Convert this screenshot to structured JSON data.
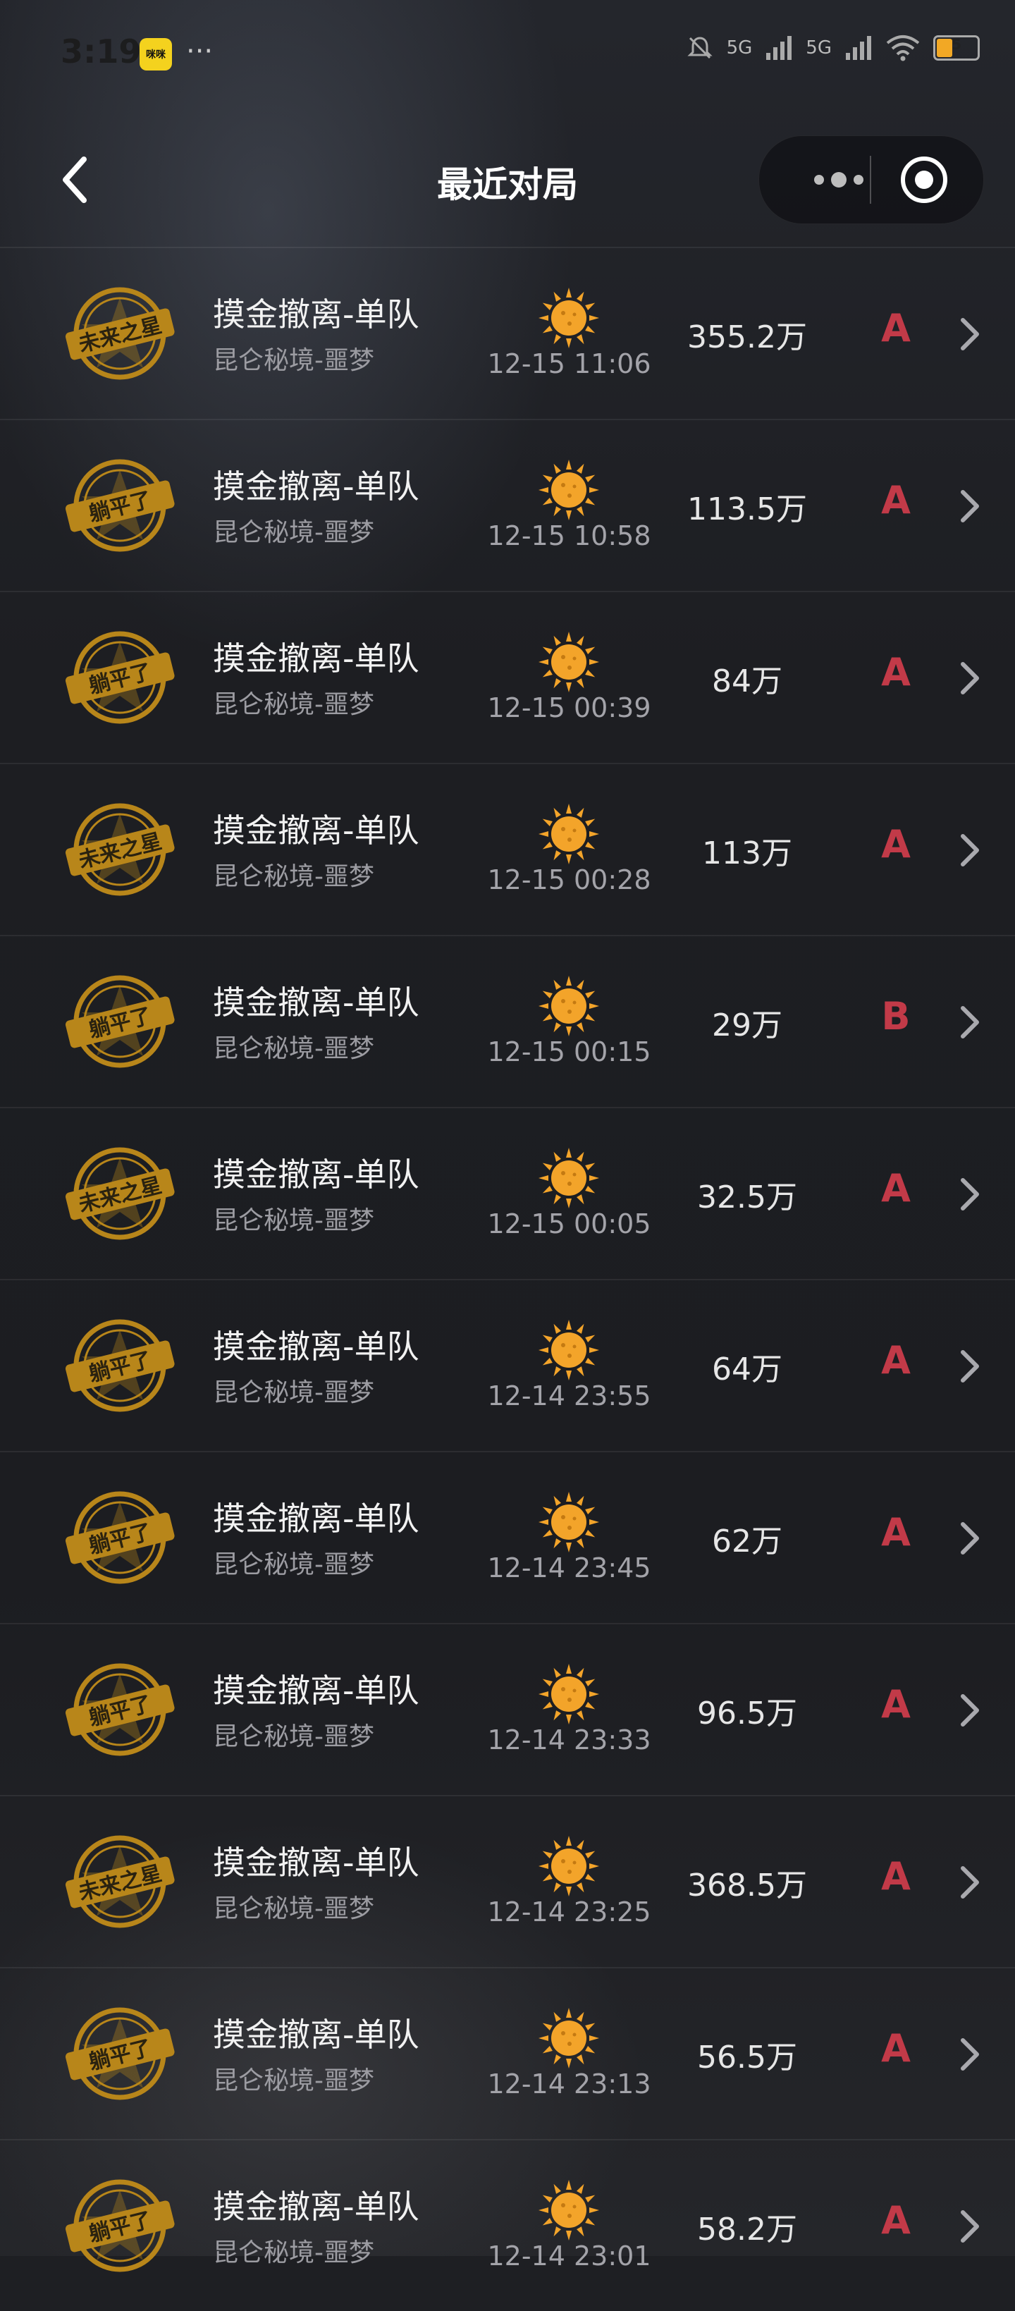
{
  "status_bar": {
    "time": "3:19",
    "app_icon_text": "咪咪",
    "more": "···",
    "battery": "5",
    "battery_color": "#f2a825",
    "network_labels": [
      "5G",
      "5G"
    ]
  },
  "header": {
    "title": "最近对局",
    "back_icon": "chevron-left-icon",
    "more_icon": "more-dots-icon",
    "close_icon": "target-close-icon"
  },
  "colors": {
    "badge_gold": "#b8861a",
    "sun_orange": "#f3a42a",
    "grade_red": "#c23a48"
  },
  "matches": [
    {
      "badge": "未来之星",
      "mode": "摸金撤离-单队",
      "map": "昆仑秘境-噩梦",
      "time": "12-15 11:06",
      "value": "355.2万",
      "grade": "A",
      "weather_icon": "sun-icon"
    },
    {
      "badge": "躺平了",
      "mode": "摸金撤离-单队",
      "map": "昆仑秘境-噩梦",
      "time": "12-15 10:58",
      "value": "113.5万",
      "grade": "A",
      "weather_icon": "sun-icon"
    },
    {
      "badge": "躺平了",
      "mode": "摸金撤离-单队",
      "map": "昆仑秘境-噩梦",
      "time": "12-15 00:39",
      "value": "84万",
      "grade": "A",
      "weather_icon": "sun-icon"
    },
    {
      "badge": "未来之星",
      "mode": "摸金撤离-单队",
      "map": "昆仑秘境-噩梦",
      "time": "12-15 00:28",
      "value": "113万",
      "grade": "A",
      "weather_icon": "sun-icon"
    },
    {
      "badge": "躺平了",
      "mode": "摸金撤离-单队",
      "map": "昆仑秘境-噩梦",
      "time": "12-15 00:15",
      "value": "29万",
      "grade": "B",
      "weather_icon": "sun-icon"
    },
    {
      "badge": "未来之星",
      "mode": "摸金撤离-单队",
      "map": "昆仑秘境-噩梦",
      "time": "12-15 00:05",
      "value": "32.5万",
      "grade": "A",
      "weather_icon": "sun-icon"
    },
    {
      "badge": "躺平了",
      "mode": "摸金撤离-单队",
      "map": "昆仑秘境-噩梦",
      "time": "12-14 23:55",
      "value": "64万",
      "grade": "A",
      "weather_icon": "sun-icon"
    },
    {
      "badge": "躺平了",
      "mode": "摸金撤离-单队",
      "map": "昆仑秘境-噩梦",
      "time": "12-14 23:45",
      "value": "62万",
      "grade": "A",
      "weather_icon": "sun-icon"
    },
    {
      "badge": "躺平了",
      "mode": "摸金撤离-单队",
      "map": "昆仑秘境-噩梦",
      "time": "12-14 23:33",
      "value": "96.5万",
      "grade": "A",
      "weather_icon": "sun-icon"
    },
    {
      "badge": "未来之星",
      "mode": "摸金撤离-单队",
      "map": "昆仑秘境-噩梦",
      "time": "12-14 23:25",
      "value": "368.5万",
      "grade": "A",
      "weather_icon": "sun-icon"
    },
    {
      "badge": "躺平了",
      "mode": "摸金撤离-单队",
      "map": "昆仑秘境-噩梦",
      "time": "12-14 23:13",
      "value": "56.5万",
      "grade": "A",
      "weather_icon": "sun-icon"
    },
    {
      "badge": "躺平了",
      "mode": "摸金撤离-单队",
      "map": "昆仑秘境-噩梦",
      "time": "12-14 23:01",
      "value": "58.2万",
      "grade": "A",
      "weather_icon": "sun-icon"
    }
  ]
}
